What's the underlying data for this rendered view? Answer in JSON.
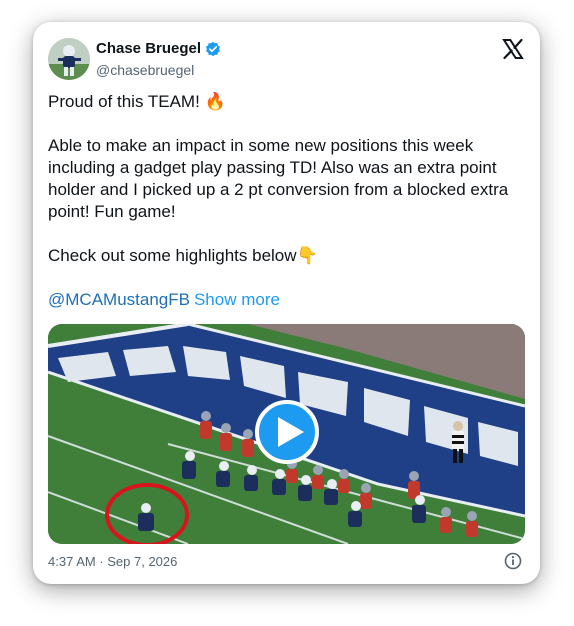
{
  "author": {
    "name": "Chase Bruegel",
    "handle": "@chasebruegel"
  },
  "post": {
    "line1": "Proud of this TEAM! ",
    "line1_emoji": "🔥",
    "para2": "Able to make an impact in some new positions this week including a gadget play passing TD! Also was an extra point holder and I picked up a 2 pt conversion from a blocked extra point! Fun game!",
    "para3": "Check out some highlights below",
    "para3_emoji": "👇",
    "mention": "@MCAMustangFB",
    "show_more": "Show more"
  },
  "media": {
    "type": "video",
    "field_text": "MUSTANG"
  },
  "footer": {
    "timestamp": "4:37 AM · Sep 7, 2026"
  },
  "icons": {
    "verified": "verified-badge-icon",
    "brand": "x-logo-icon",
    "play": "play-icon",
    "info": "info-icon"
  },
  "colors": {
    "verified": "#1d9bf0",
    "link": "#1d9bf0",
    "play_button": "#1d9bf0",
    "field_endzone": "#1f3f86",
    "field_grass": "#3f7f3a",
    "highlight_circle": "#d8141c"
  }
}
